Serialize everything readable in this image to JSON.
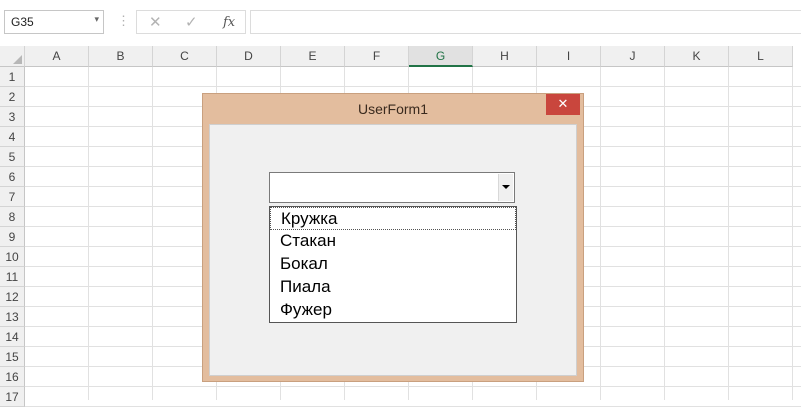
{
  "formula_bar": {
    "name_box": "G35",
    "name_box_dropdown": "▾",
    "separator": "⋮",
    "cancel_icon": "✕",
    "enter_icon": "✓",
    "fx_label": "fx",
    "formula": ""
  },
  "columns": [
    "A",
    "B",
    "C",
    "D",
    "E",
    "F",
    "G",
    "H",
    "I",
    "J",
    "K",
    "L"
  ],
  "selected_column": "G",
  "rows": [
    "1",
    "2",
    "3",
    "4",
    "5",
    "6",
    "7",
    "8",
    "9",
    "10",
    "11",
    "12",
    "13",
    "14",
    "15",
    "16",
    "17"
  ],
  "userform": {
    "title": "UserForm1",
    "close_label": "✕",
    "combobox_value": "",
    "options": [
      "Кружка",
      "Стакан",
      "Бокал",
      "Пиала",
      "Фужер"
    ],
    "focused_option": "Кружка"
  },
  "colors": {
    "form_frame": "#e3bd9e",
    "close_button": "#c9463d",
    "selected_column_accent": "#217346"
  }
}
